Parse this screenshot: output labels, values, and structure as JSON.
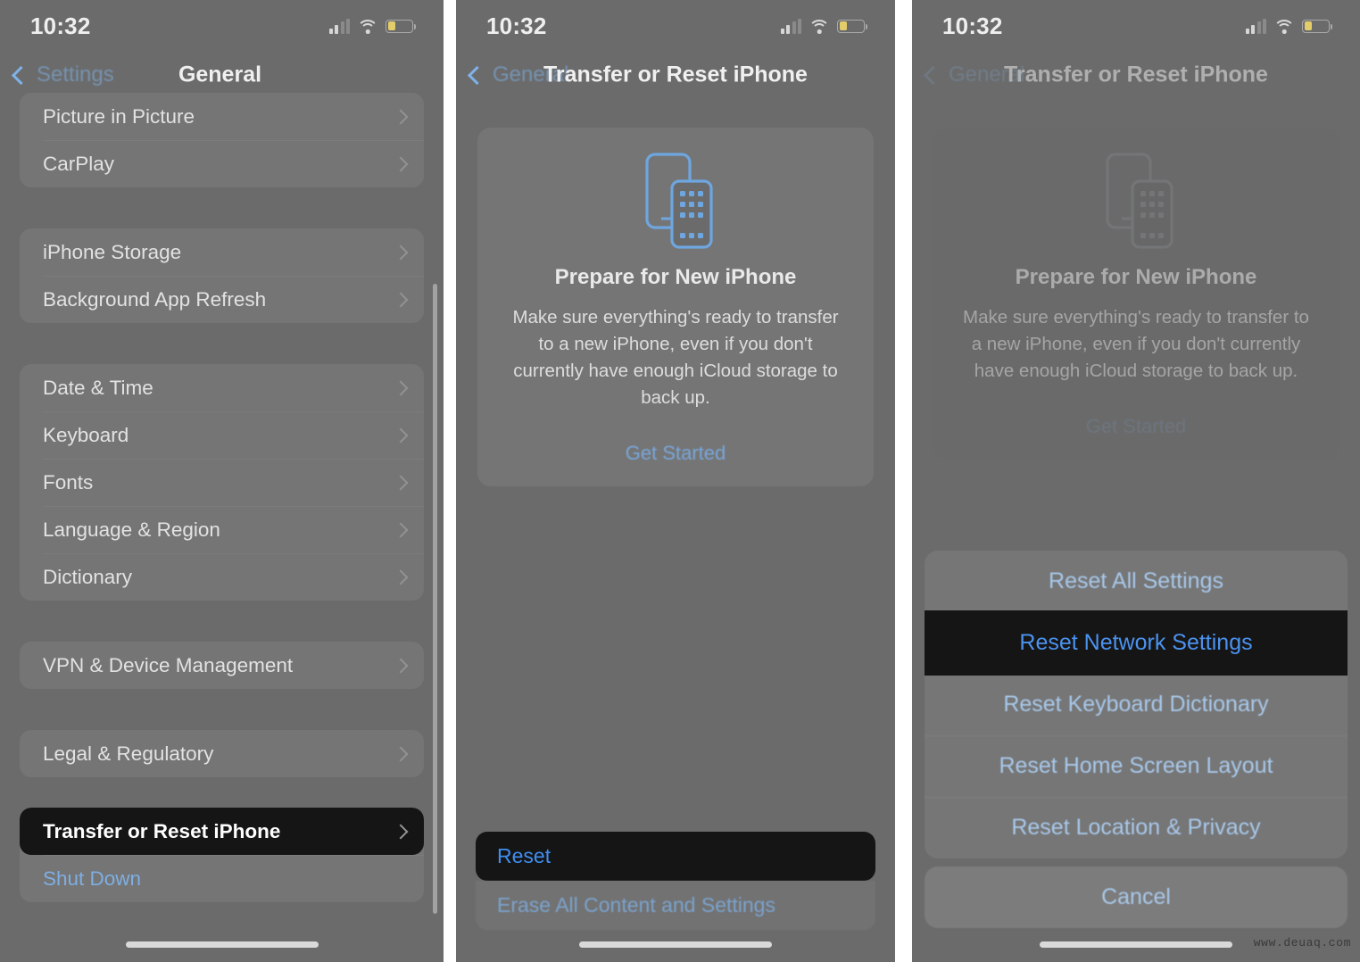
{
  "status_bar": {
    "time": "10:32",
    "cellular_icon": "cellular-signal-icon",
    "wifi_icon": "wifi-icon",
    "battery_icon": "battery-low-icon",
    "battery_color": "#e3cd6b"
  },
  "colors": {
    "screen_bg": "#6b6b6b",
    "group_bg": "#757575",
    "accent_blue": "#7fb2e8",
    "highlight_bg": "#151515",
    "highlight_text": "#ffffff",
    "label_text": "#e8e8e8"
  },
  "panel1": {
    "nav": {
      "back_label": "Settings",
      "title": "General",
      "back_icon": "chevron-left-icon"
    },
    "groups": [
      {
        "rows": [
          {
            "label": "Picture in Picture",
            "accessory": "chevron-right-icon",
            "style": "normal"
          },
          {
            "label": "CarPlay",
            "accessory": "chevron-right-icon",
            "style": "normal"
          }
        ]
      },
      {
        "rows": [
          {
            "label": "iPhone Storage",
            "accessory": "chevron-right-icon",
            "style": "normal"
          },
          {
            "label": "Background App Refresh",
            "accessory": "chevron-right-icon",
            "style": "normal"
          }
        ]
      },
      {
        "rows": [
          {
            "label": "Date & Time",
            "accessory": "chevron-right-icon",
            "style": "normal"
          },
          {
            "label": "Keyboard",
            "accessory": "chevron-right-icon",
            "style": "normal"
          },
          {
            "label": "Fonts",
            "accessory": "chevron-right-icon",
            "style": "normal"
          },
          {
            "label": "Language & Region",
            "accessory": "chevron-right-icon",
            "style": "normal"
          },
          {
            "label": "Dictionary",
            "accessory": "chevron-right-icon",
            "style": "normal"
          }
        ]
      },
      {
        "rows": [
          {
            "label": "VPN & Device Management",
            "accessory": "chevron-right-icon",
            "style": "normal"
          }
        ]
      },
      {
        "rows": [
          {
            "label": "Legal & Regulatory",
            "accessory": "chevron-right-icon",
            "style": "normal"
          }
        ]
      },
      {
        "rows": [
          {
            "label": "Transfer or Reset iPhone",
            "accessory": "chevron-right-icon",
            "style": "highlighted"
          },
          {
            "label": "Shut Down",
            "accessory": "",
            "style": "link"
          }
        ]
      }
    ],
    "scroll_indicator": "vertical-scrollbar",
    "home_indicator": "home-indicator"
  },
  "panel2": {
    "nav": {
      "back_label": "General",
      "title": "Transfer or Reset iPhone",
      "back_icon": "chevron-left-icon"
    },
    "prepare_card": {
      "icon": "two-iphones-icon",
      "title": "Prepare for New iPhone",
      "body": "Make sure everything's ready to transfer to a new iPhone, even if you don't currently have enough iCloud storage to back up.",
      "cta": "Get Started"
    },
    "bottom_rows": [
      {
        "label": "Reset",
        "style": "highlighted"
      },
      {
        "label": "Erase All Content and Settings",
        "style": "normal"
      }
    ],
    "home_indicator": "home-indicator"
  },
  "panel3": {
    "nav": {
      "back_label": "General",
      "title": "Transfer or Reset iPhone",
      "back_icon": "chevron-left-icon"
    },
    "prepare_card": {
      "icon": "two-iphones-icon",
      "title": "Prepare for New iPhone",
      "body": "Make sure everything's ready to transfer to a new iPhone, even if you don't currently have enough iCloud storage to back up.",
      "cta": "Get Started"
    },
    "action_sheet": {
      "items": [
        {
          "label": "Reset All Settings",
          "style": "normal"
        },
        {
          "label": "Reset Network Settings",
          "style": "highlighted"
        },
        {
          "label": "Reset Keyboard Dictionary",
          "style": "normal"
        },
        {
          "label": "Reset Home Screen Layout",
          "style": "normal"
        },
        {
          "label": "Reset Location & Privacy",
          "style": "normal"
        }
      ],
      "cancel_label": "Cancel"
    },
    "home_indicator": "home-indicator"
  },
  "watermark": "www.deuaq.com"
}
